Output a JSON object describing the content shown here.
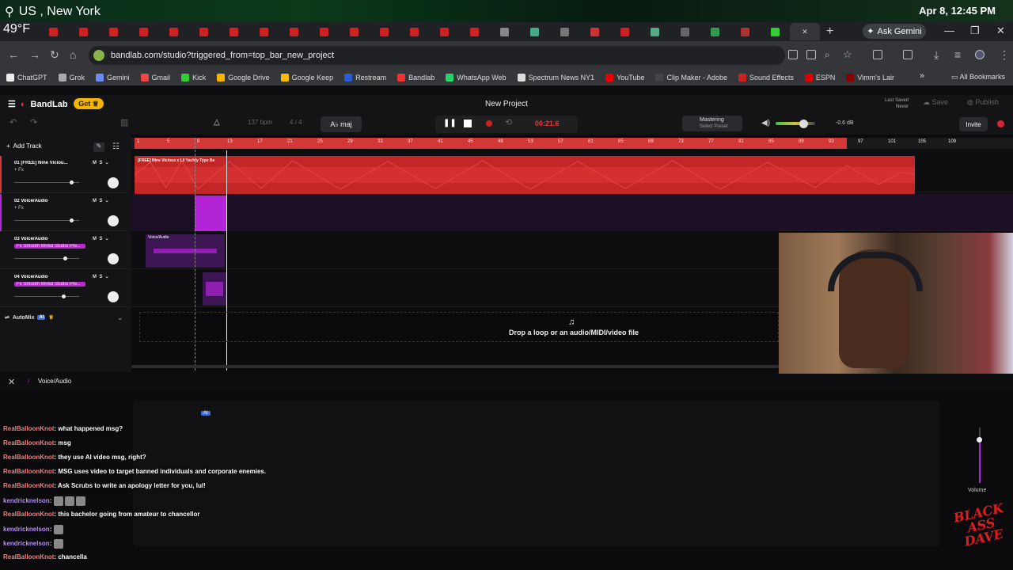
{
  "overlay": {
    "location": "US , New York",
    "temperature": "49°F",
    "datetime": "Apr 8, 12:45 PM"
  },
  "browser": {
    "ask_gemini": "Ask Gemini",
    "url": "bandlab.com/studio?triggered_from=top_bar_new_project",
    "bookmarks": [
      "ChatGPT",
      "Grok",
      "Gemini",
      "Gmail",
      "Kick",
      "Google Drive",
      "Google Keep",
      "Restream",
      "Bandlab",
      "WhatsApp Web",
      "Spectrum News NY1",
      "YouTube",
      "Clip Maker - Adobe",
      "Sound Effects",
      "ESPN",
      "Vimm's Lair"
    ],
    "all_bookmarks": "All Bookmarks"
  },
  "bandlab": {
    "logo": "BandLab",
    "get_label": "Get",
    "project_title": "New Project",
    "last_saved_label": "Last Saved",
    "last_saved_value": "Never",
    "save_label": "Save",
    "publish_label": "Publish",
    "bpm": "137 bpm",
    "time_sig": "4 / 4",
    "key": "A♭ maj",
    "time": "00:21.6",
    "mastering": "Mastering",
    "mastering_sub": "Select Preset",
    "db": "-0.6 dB",
    "invite": "Invite",
    "add_track": "Add Track",
    "automix": "AutoMix",
    "ai": "AI",
    "drop_text": "Drop a loop or an audio/MIDI/video file",
    "ruler": [
      "1",
      "5",
      "9",
      "13",
      "17",
      "21",
      "25",
      "29",
      "33",
      "37",
      "41",
      "45",
      "49",
      "53",
      "57",
      "61",
      "65",
      "69",
      "73",
      "77",
      "81",
      "85",
      "89",
      "93",
      "97",
      "101",
      "105",
      "109"
    ]
  },
  "tracks": [
    {
      "name": "01  [FREE] Nine Viciou...",
      "fx": "+ Fx",
      "color": "#d23838"
    },
    {
      "name": "02  Voice/Audio",
      "fx": "+ Fx",
      "color": "#b324d9"
    },
    {
      "name": "03  Voice/Audio",
      "fx": "Fx Smooth Wired Studio Pre...",
      "color": "#b324d9"
    },
    {
      "name": "04  Voice/Audio",
      "fx": "Fx Smooth Wired Studio Pre...",
      "color": "#b324d9"
    }
  ],
  "clips": {
    "clip1_label": "[FREE] Nine Vicious x Lil Yachty Type Be",
    "clip3_label": "Voice/Audio"
  },
  "editor": {
    "title": "Voice/Audio",
    "ai": "AI",
    "volume": "Volume"
  },
  "chat": [
    {
      "user": "RealBalloonKnot",
      "text": "what happened msg?",
      "purple": false
    },
    {
      "user": "RealBalloonKnot",
      "text": "msg",
      "purple": false
    },
    {
      "user": "RealBalloonKnot",
      "text": "they use AI video msg, right?",
      "purple": false
    },
    {
      "user": "RealBalloonKnot",
      "text": "MSG uses video to target banned individuals and corporate enemies.",
      "purple": false
    },
    {
      "user": "RealBalloonKnot",
      "text": "Ask Scrubs to write an apology letter for you, lul!",
      "purple": false
    },
    {
      "user": "kendricknelson",
      "text": "",
      "purple": true,
      "emotes": 3
    },
    {
      "user": "RealBalloonKnot",
      "text": "this bachelor going from amateur to chancellor",
      "purple": false
    },
    {
      "user": "kendricknelson",
      "text": "",
      "purple": true,
      "emotes": 1
    },
    {
      "user": "kendricknelson",
      "text": "",
      "purple": true,
      "emotes": 1
    },
    {
      "user": "RealBalloonKnot",
      "text": "chancella",
      "purple": false
    }
  ],
  "watermark": "BLACK ASS DAVE"
}
